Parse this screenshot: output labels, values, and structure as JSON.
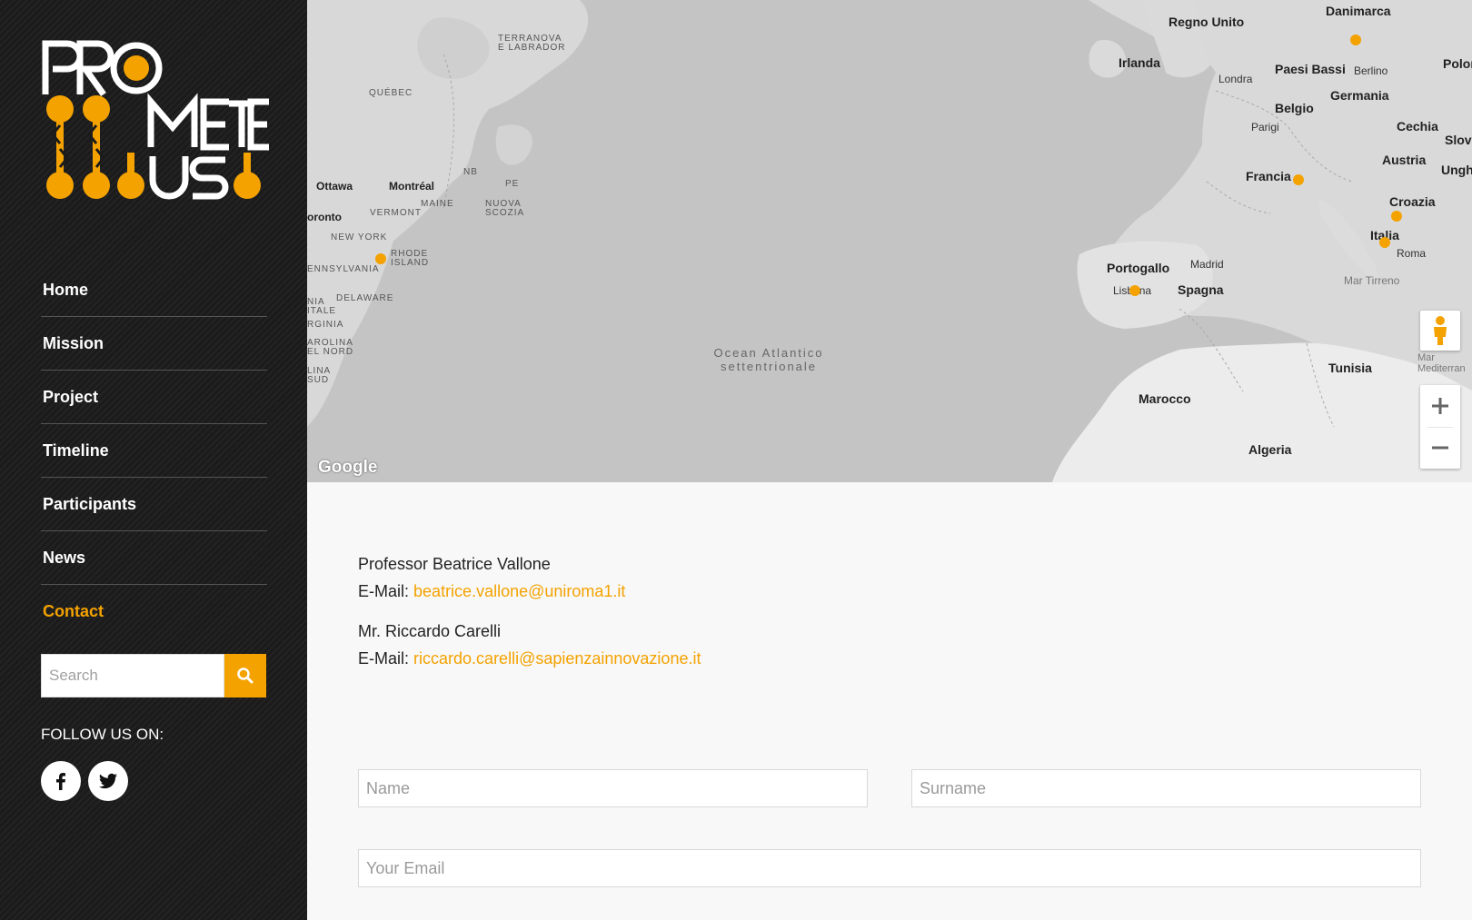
{
  "logo": {
    "text": "PROMETEUS"
  },
  "nav": {
    "items": [
      {
        "label": "Home"
      },
      {
        "label": "Mission"
      },
      {
        "label": "Project"
      },
      {
        "label": "Timeline"
      },
      {
        "label": "Participants"
      },
      {
        "label": "News"
      },
      {
        "label": "Contact",
        "active": true
      }
    ]
  },
  "search": {
    "placeholder": "Search",
    "icon": "search-icon"
  },
  "follow": {
    "label": "FOLLOW US ON:",
    "icons": [
      "facebook-icon",
      "twitter-icon"
    ]
  },
  "map": {
    "attribution": "Google",
    "labels": {
      "danimarca": "Danimarca",
      "regno_unito": "Regno Unito",
      "irlanda": "Irlanda",
      "polon": "Polon",
      "londra": "Londra",
      "paesi_bassi": "Paesi Bassi",
      "berlino": "Berlino",
      "germania": "Germania",
      "belgio": "Belgio",
      "parigi": "Parigi",
      "cechia": "Cechia",
      "slov": "Slov",
      "austria": "Austria",
      "ungh": "Ungh",
      "francia": "Francia",
      "croazia": "Croazia",
      "italia": "Italia",
      "roma": "Roma",
      "mar_tirreno": "Mar Tirreno",
      "portogallo": "Portogallo",
      "madrid": "Madrid",
      "lisbona": "Lisbona",
      "spagna": "Spagna",
      "tunisia": "Tunisia",
      "mar_med": "Mar Mediterran",
      "marocco": "Marocco",
      "algeria": "Algeria",
      "ocean1": "Ocean Atlantico",
      "ocean2": "settentrionale",
      "terranova": "TERRANOVA",
      "labrador": "E LABRADOR",
      "quebec": "QUÉBEC",
      "ottawa": "Ottawa",
      "montreal": "Montréal",
      "nb": "NB",
      "pe": "PE",
      "maine": "MAINE",
      "vermont": "VERMONT",
      "nuova": "NUOVA",
      "scozia": "SCOZIA",
      "toronto": "oronto",
      "new_york": "NEW YORK",
      "rhode": "RHODE",
      "island": "ISLAND",
      "pennsylvania": "ENNSYLVANIA",
      "delaware": "DELAWARE",
      "va1": "NIA",
      "va2": "ITALE",
      "va3": "RGINIA",
      "nc1": "AROLINA",
      "nc2": "EL NORD",
      "sc1": "LINA",
      "sc2": "SUD"
    }
  },
  "contacts": [
    {
      "name": "Professor Beatrice Vallone",
      "email_label": "E-Mail:",
      "email": "beatrice.vallone@uniroma1.it"
    },
    {
      "name": "Mr. Riccardo Carelli",
      "email_label": "E-Mail:",
      "email": "riccardo.carelli@sapienzainnovazione.it"
    }
  ],
  "form": {
    "name_placeholder": "Name",
    "surname_placeholder": "Surname",
    "email_placeholder": "Your Email"
  },
  "colors": {
    "accent": "#f4a200",
    "sidebar": "#1b1b1b",
    "map_water": "#c4c4c4"
  }
}
